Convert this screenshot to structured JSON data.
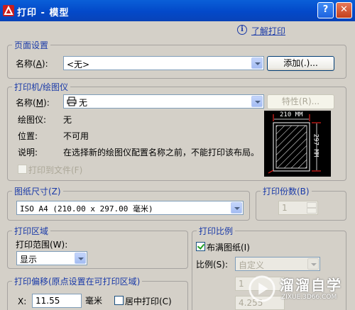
{
  "window": {
    "title": "打印 - 模型",
    "help_label": "?",
    "close_label": "✕"
  },
  "help": {
    "link": "了解打印"
  },
  "page_setup": {
    "group_title": "页面设置",
    "name_label": "名称(",
    "name_key": "A",
    "name_tail": "):",
    "name_value": "<无>",
    "add_button": "添加(.)..."
  },
  "printer": {
    "group_title": "打印机/绘图仪",
    "name_label": "名称(",
    "name_key": "M",
    "name_tail": "):",
    "name_value": "无",
    "properties_button": "特性(R)...",
    "plotter_label": "绘图仪:",
    "plotter_value": "无",
    "location_label": "位置:",
    "location_value": "不可用",
    "description_label": "说明:",
    "description_value": "在选择新的绘图仪配置名称之前，不能打印该布局。",
    "print_to_file": "打印到文件(F)",
    "preview_width": "210 MM",
    "preview_height": "297 MM"
  },
  "paper_size": {
    "group_title": "图纸尺寸(Z)",
    "value": "ISO A4 (210.00 x 297.00 毫米)"
  },
  "copies": {
    "group_title": "打印份数(B)",
    "value": "1"
  },
  "plot_area": {
    "group_title": "打印区域",
    "range_label": "打印范围(W):",
    "range_value": "显示"
  },
  "plot_scale": {
    "group_title": "打印比例",
    "fit_paper": "布满图纸(I)",
    "fit_paper_checked": true,
    "scale_label": "比例(S):",
    "scale_value": "自定义",
    "value_1": "1",
    "value_2": "4.255"
  },
  "plot_offset": {
    "group_title": "打印偏移(原点设置在可打印区域)",
    "x_label": "X:",
    "x_value": "11.55",
    "unit": "毫米",
    "center_plot": "居中打印(C)"
  },
  "watermark": {
    "brand": "溜溜自学",
    "url": "ZIXUE.3D66.COM"
  },
  "colors": {
    "title_bar": "#0a5fd8",
    "group_title": "#1a3aa8",
    "dialog_bg": "#d4d0c8",
    "preview_red": "#e0201c"
  }
}
